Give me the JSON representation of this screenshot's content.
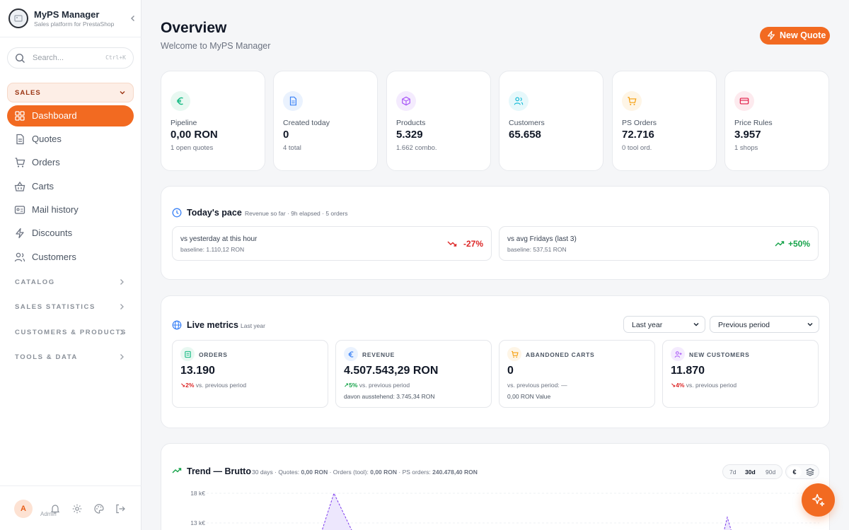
{
  "app": {
    "name": "MyPS Manager",
    "tagline": "Sales platform for PrestaShop",
    "accent_color": "#f26a21"
  },
  "search": {
    "placeholder": "Search...",
    "shortcut": "Ctrl+K"
  },
  "sidebar": {
    "section": "SALES",
    "items": [
      {
        "label": "Dashboard",
        "icon": "dashboard-grid-icon",
        "active": true
      },
      {
        "label": "Quotes",
        "icon": "document-icon"
      },
      {
        "label": "Orders",
        "icon": "cart-icon"
      },
      {
        "label": "Carts",
        "icon": "basket-icon"
      },
      {
        "label": "Mail history",
        "icon": "mail-card-icon"
      },
      {
        "label": "Discounts",
        "icon": "lightning-icon"
      },
      {
        "label": "Customers",
        "icon": "users-icon"
      }
    ],
    "groups": [
      "CATALOG",
      "SALES STATISTICS",
      "CUSTOMERS & PRODUCTS",
      "TOOLS & DATA"
    ],
    "footer": {
      "avatar": "A",
      "user": "Admin"
    }
  },
  "header": {
    "title": "Overview",
    "subtitle": "Welcome to MyPS Manager",
    "new_quote": "New Quote"
  },
  "kpis": [
    {
      "label": "Pipeline",
      "value": "0,00 RON",
      "sub": "1 open quotes",
      "icon": "euro-icon",
      "color": "#10b981"
    },
    {
      "label": "Created today",
      "value": "0",
      "sub": "4 total",
      "icon": "document-icon",
      "color": "#3b82f6"
    },
    {
      "label": "Products",
      "value": "5.329",
      "sub": "1.662 combo.",
      "icon": "box-icon",
      "color": "#a855f7"
    },
    {
      "label": "Customers",
      "value": "65.658",
      "sub": "",
      "icon": "users-icon",
      "color": "#06b6d4"
    },
    {
      "label": "PS Orders",
      "value": "72.716",
      "sub": "0 tool ord.",
      "icon": "cart-icon",
      "color": "#f59e0b"
    },
    {
      "label": "Price Rules",
      "value": "3.957",
      "sub": "1 shops",
      "icon": "card-icon",
      "color": "#e11d48"
    }
  ],
  "pace": {
    "title": "Today's pace",
    "note": "Revenue so far · 9h elapsed · 5 orders",
    "boxes": [
      {
        "title": "vs yesterday at this hour",
        "baseline": "baseline: 1.110,12 RON",
        "value": "-27%",
        "trend": "down"
      },
      {
        "title": "vs avg Fridays (last 3)",
        "baseline": "baseline: 537,51 RON",
        "value": "+50%",
        "trend": "up"
      }
    ]
  },
  "live": {
    "title": "Live metrics",
    "note": "Last year",
    "select_range": "Last year",
    "select_compare": "Previous period",
    "metrics": [
      {
        "label": "ORDERS",
        "value": "13.190",
        "delta": "2%",
        "trend": "down",
        "cmp": "vs. previous period",
        "extra": "",
        "icon": "receipt-icon",
        "color": "#10b981"
      },
      {
        "label": "REVENUE",
        "value": "4.507.543,29 RON",
        "delta": "5%",
        "trend": "up",
        "cmp": "vs. previous period",
        "extra": "davon ausstehend: 3.745,34 RON",
        "icon": "euro-icon",
        "color": "#3b82f6"
      },
      {
        "label": "ABANDONED CARTS",
        "value": "0",
        "delta": "",
        "trend": "",
        "cmp": "vs. previous period: —",
        "extra": "0,00 RON Value",
        "icon": "cart-icon",
        "color": "#f59e0b"
      },
      {
        "label": "NEW CUSTOMERS",
        "value": "11.870",
        "delta": "4%",
        "trend": "down",
        "cmp": "vs. previous period",
        "extra": "",
        "icon": "user-plus-icon",
        "color": "#a855f7"
      }
    ]
  },
  "trend": {
    "title": "Trend — Brutto",
    "summary_prefix": "30 days · Quotes: ",
    "quotes": "0,00 RON",
    "orders_prefix": " · Orders (tool): ",
    "orders": "0,00 RON",
    "ps_prefix": " · PS orders: ",
    "ps": "240.478,40 RON",
    "ranges": [
      "7d",
      "30d",
      "90d"
    ],
    "selected_range": "30d",
    "unit": "€",
    "y_ticks": [
      "18 k€",
      "13 k€"
    ]
  }
}
